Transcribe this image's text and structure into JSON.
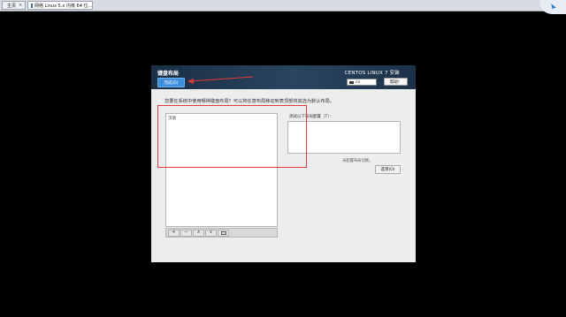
{
  "tabs": [
    {
      "label": "主页"
    },
    {
      "label": "网络 Linux 5.x 内核 64 位..."
    }
  ],
  "installer": {
    "page_title": "键盘布局",
    "done_button": "完成(D)",
    "product_title": "CENTOS LINUX 7 安装",
    "keyboard_indicator": "cn",
    "help_button": "帮助！",
    "question": "您要在系统中使用哪种键盘布局？可以将任意布局移动到表顶部将其选为默认布局。",
    "layouts": [
      "汉语"
    ],
    "toolbar": {
      "add": "+",
      "remove": "−",
      "up": "∧",
      "down": "∨"
    },
    "test_label": "测试以下布局配置（T）：",
    "switch_status": "未配置布局切换。",
    "options_button": "选项(O)"
  },
  "colors": {
    "annotation": "#e03a3a",
    "done_button": "#3e8ede",
    "header": "#1b2f45"
  },
  "icons": [
    "home-icon",
    "vm-icon",
    "close-icon",
    "keyboard-icon",
    "keyboard-preview-icon"
  ]
}
